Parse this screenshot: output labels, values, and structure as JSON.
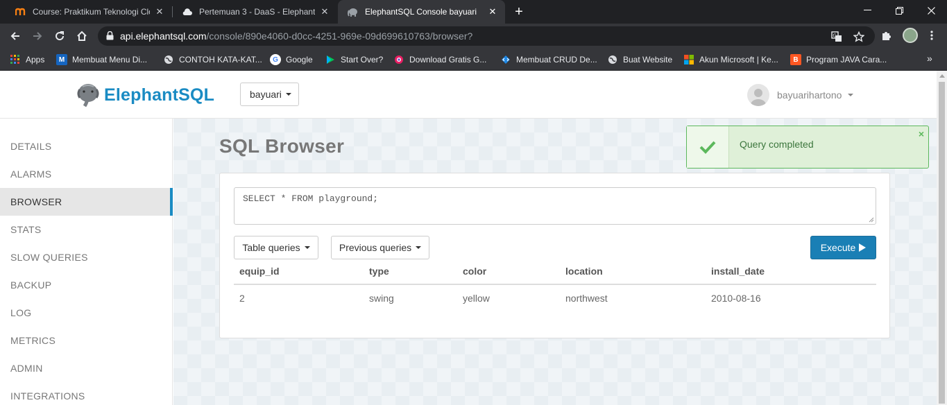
{
  "browser": {
    "tabs": [
      {
        "title": "Course: Praktikum Teknologi Clou",
        "favicon": "moodle-icon",
        "active": false
      },
      {
        "title": "Pertemuan 3 - DaaS - ElephantSQ",
        "favicon": "cloud-icon",
        "active": false
      },
      {
        "title": "ElephantSQL Console bayuari",
        "favicon": "elephant-icon",
        "active": true
      }
    ],
    "url_host": "api.elephantsql.com",
    "url_path": "/console/890e4060-d0cc-4251-969e-09d699610763/browser?",
    "bookmarks": [
      {
        "label": "Apps",
        "icon": "apps-grid-icon",
        "color": "#ea4335"
      },
      {
        "label": "Membuat Menu Di...",
        "icon": "m-icon",
        "color": "#1565c0"
      },
      {
        "label": "CONTOH KATA-KAT...",
        "icon": "globe-icon",
        "color": "#9aa0a6"
      },
      {
        "label": "Google",
        "icon": "google-icon",
        "color": "#4285f4"
      },
      {
        "label": "Start Over?",
        "icon": "play-store-icon",
        "color": "#00c853"
      },
      {
        "label": "Download Gratis G...",
        "icon": "chrome-ring-icon",
        "color": "#e91e63"
      },
      {
        "label": "Membuat CRUD De...",
        "icon": "diamond-code-icon",
        "color": "#1e88e5"
      },
      {
        "label": "Buat Website",
        "icon": "globe-icon",
        "color": "#9aa0a6"
      },
      {
        "label": "Akun Microsoft | Ke...",
        "icon": "microsoft-icon",
        "color": "#f25022"
      },
      {
        "label": "Program JAVA Cara...",
        "icon": "blogger-icon",
        "color": "#ff5722"
      }
    ]
  },
  "header": {
    "brand": "ElephantSQL",
    "instance": "bayuari",
    "username": "bayuarihartono"
  },
  "sidebar": {
    "items": [
      {
        "label": "DETAILS",
        "active": false
      },
      {
        "label": "ALARMS",
        "active": false
      },
      {
        "label": "BROWSER",
        "active": true
      },
      {
        "label": "STATS",
        "active": false
      },
      {
        "label": "SLOW QUERIES",
        "active": false
      },
      {
        "label": "BACKUP",
        "active": false
      },
      {
        "label": "LOG",
        "active": false
      },
      {
        "label": "METRICS",
        "active": false
      },
      {
        "label": "ADMIN",
        "active": false
      },
      {
        "label": "INTEGRATIONS",
        "active": false
      }
    ]
  },
  "main": {
    "title": "SQL Browser",
    "query": "SELECT * FROM playground;",
    "table_queries_label": "Table queries",
    "previous_queries_label": "Previous queries",
    "execute_label": "Execute",
    "columns": [
      "equip_id",
      "type",
      "color",
      "location",
      "install_date"
    ],
    "rows": [
      [
        "2",
        "swing",
        "yellow",
        "northwest",
        "2010-08-16"
      ]
    ]
  },
  "toast": {
    "message": "Query completed",
    "close": "×"
  },
  "colors": {
    "brand": "#1a8bc3",
    "primary_button": "#1a7fb5",
    "success": "#5cb85c",
    "success_text": "#3c763d"
  }
}
